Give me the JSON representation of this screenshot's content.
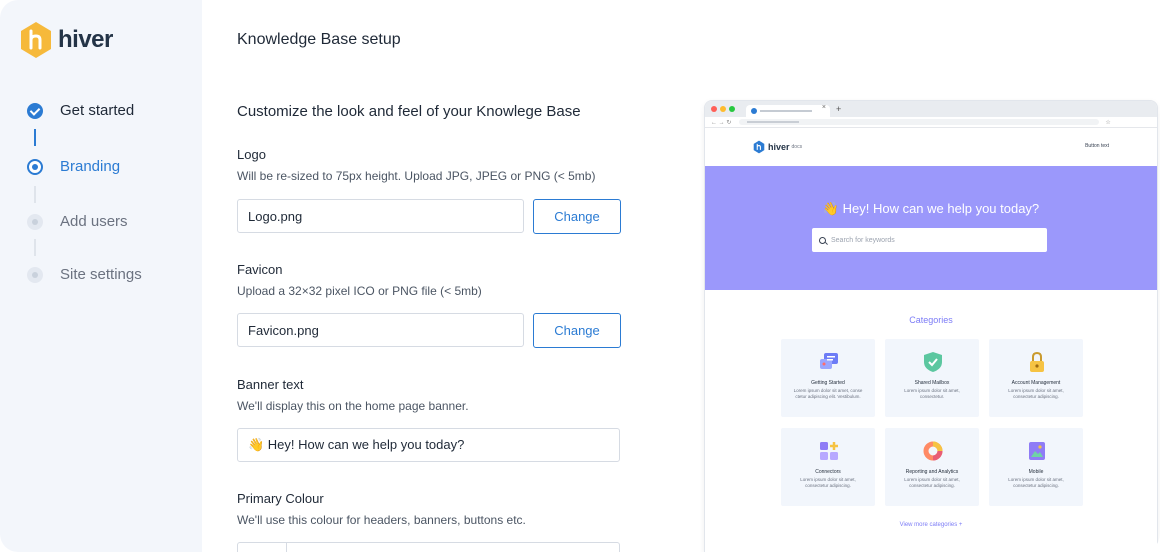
{
  "brand": {
    "name": "hiver",
    "accent": "#2b7bd3",
    "logo_color": "#f6b93b"
  },
  "sidebar": {
    "steps": [
      {
        "label": "Get started",
        "state": "done"
      },
      {
        "label": "Branding",
        "state": "active"
      },
      {
        "label": "Add users",
        "state": "todo"
      },
      {
        "label": "Site settings",
        "state": "todo"
      }
    ]
  },
  "main": {
    "title": "Knowledge Base setup",
    "section_title": "Customize the look and feel of your Knowlege Base",
    "logo": {
      "label": "Logo",
      "help": "Will be re-sized to 75px height. Upload JPG, JPEG or PNG (< 5mb)",
      "value": "Logo.png",
      "button": "Change"
    },
    "favicon": {
      "label": "Favicon",
      "help": "Upload a 32×32 pixel ICO or PNG file (< 5mb)",
      "value": "Favicon.png",
      "button": "Change"
    },
    "banner_text": {
      "label": "Banner text",
      "help": "We'll display this on the home page banner.",
      "value": "👋 Hey! How can we help you today?"
    },
    "primary_colour": {
      "label": "Primary Colour",
      "help": "We'll use this colour for headers, banners, buttons etc."
    }
  },
  "preview": {
    "logo_text": "hiver",
    "logo_suffix": "docs",
    "button_text": "Button text",
    "banner_text": "👋 Hey! How can we help you today?",
    "banner_color": "#9b98fb",
    "search_placeholder": "Search for keywords",
    "categories_title": "Categories",
    "categories": [
      {
        "name": "Getting Started",
        "desc": "Lorem ipsum dolor sit amet, conse ctetur adipiscing elit. Vestibulum.",
        "icon": "chat-bubbles-icon"
      },
      {
        "name": "Shared Mailbox",
        "desc": "Lorem ipsum dolor sit amet, consectetur.",
        "icon": "shield-check-icon"
      },
      {
        "name": "Account Management",
        "desc": "Lorem ipsum dolor sit amet, consectetur adipiscing.",
        "icon": "padlock-icon"
      },
      {
        "name": "Connectors",
        "desc": "Lorem ipsum dolor sit amet, consectetur adipiscing.",
        "icon": "connector-blocks-icon"
      },
      {
        "name": "Reporting and Analytics",
        "desc": "Lorem ipsum dolor sit amet, consectetur adipiscing.",
        "icon": "donut-chart-icon"
      },
      {
        "name": "Mobile",
        "desc": "Lorem ipsum dolor sit amet, consectetur adipiscing.",
        "icon": "mobile-image-icon"
      }
    ],
    "view_more": "View more categories +"
  }
}
